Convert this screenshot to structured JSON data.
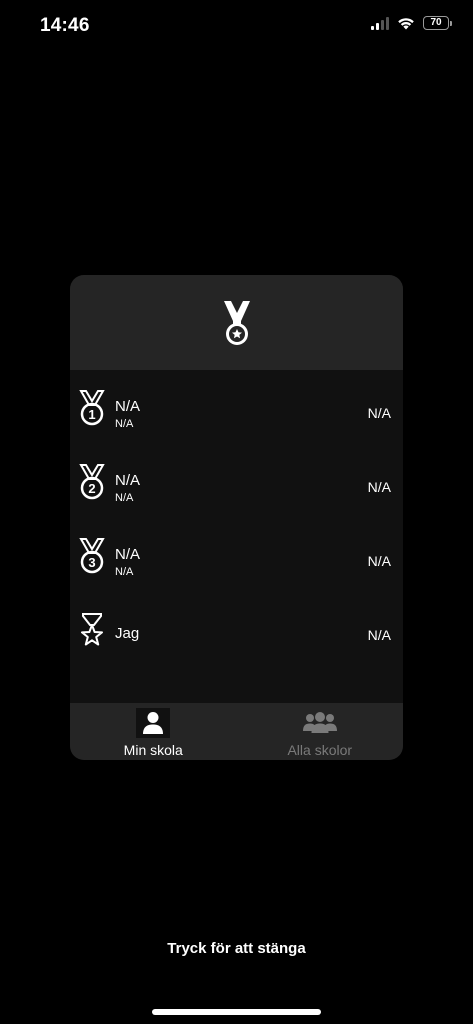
{
  "status_bar": {
    "time": "14:46",
    "battery_level": "70"
  },
  "card": {
    "header_icon": "medal-icon",
    "rows": [
      {
        "rank": "1",
        "icon": "medal-first-icon",
        "name": "N/A",
        "sub": "N/A",
        "score": "N/A"
      },
      {
        "rank": "2",
        "icon": "medal-second-icon",
        "name": "N/A",
        "sub": "N/A",
        "score": "N/A"
      },
      {
        "rank": "3",
        "icon": "medal-third-icon",
        "name": "N/A",
        "sub": "N/A",
        "score": "N/A"
      },
      {
        "rank": "me",
        "icon": "hourglass-star-icon",
        "name": "Jag",
        "sub": "",
        "score": "N/A"
      }
    ],
    "tabs": [
      {
        "label": "Min skola",
        "icon": "person-icon",
        "active": true
      },
      {
        "label": "Alla skolor",
        "icon": "group-icon",
        "active": false
      }
    ]
  },
  "close_hint": "Tryck för att stänga",
  "colors": {
    "background": "#000000",
    "card_body": "#111111",
    "card_header": "#252525",
    "inactive_tab": "#7a7a7a"
  }
}
